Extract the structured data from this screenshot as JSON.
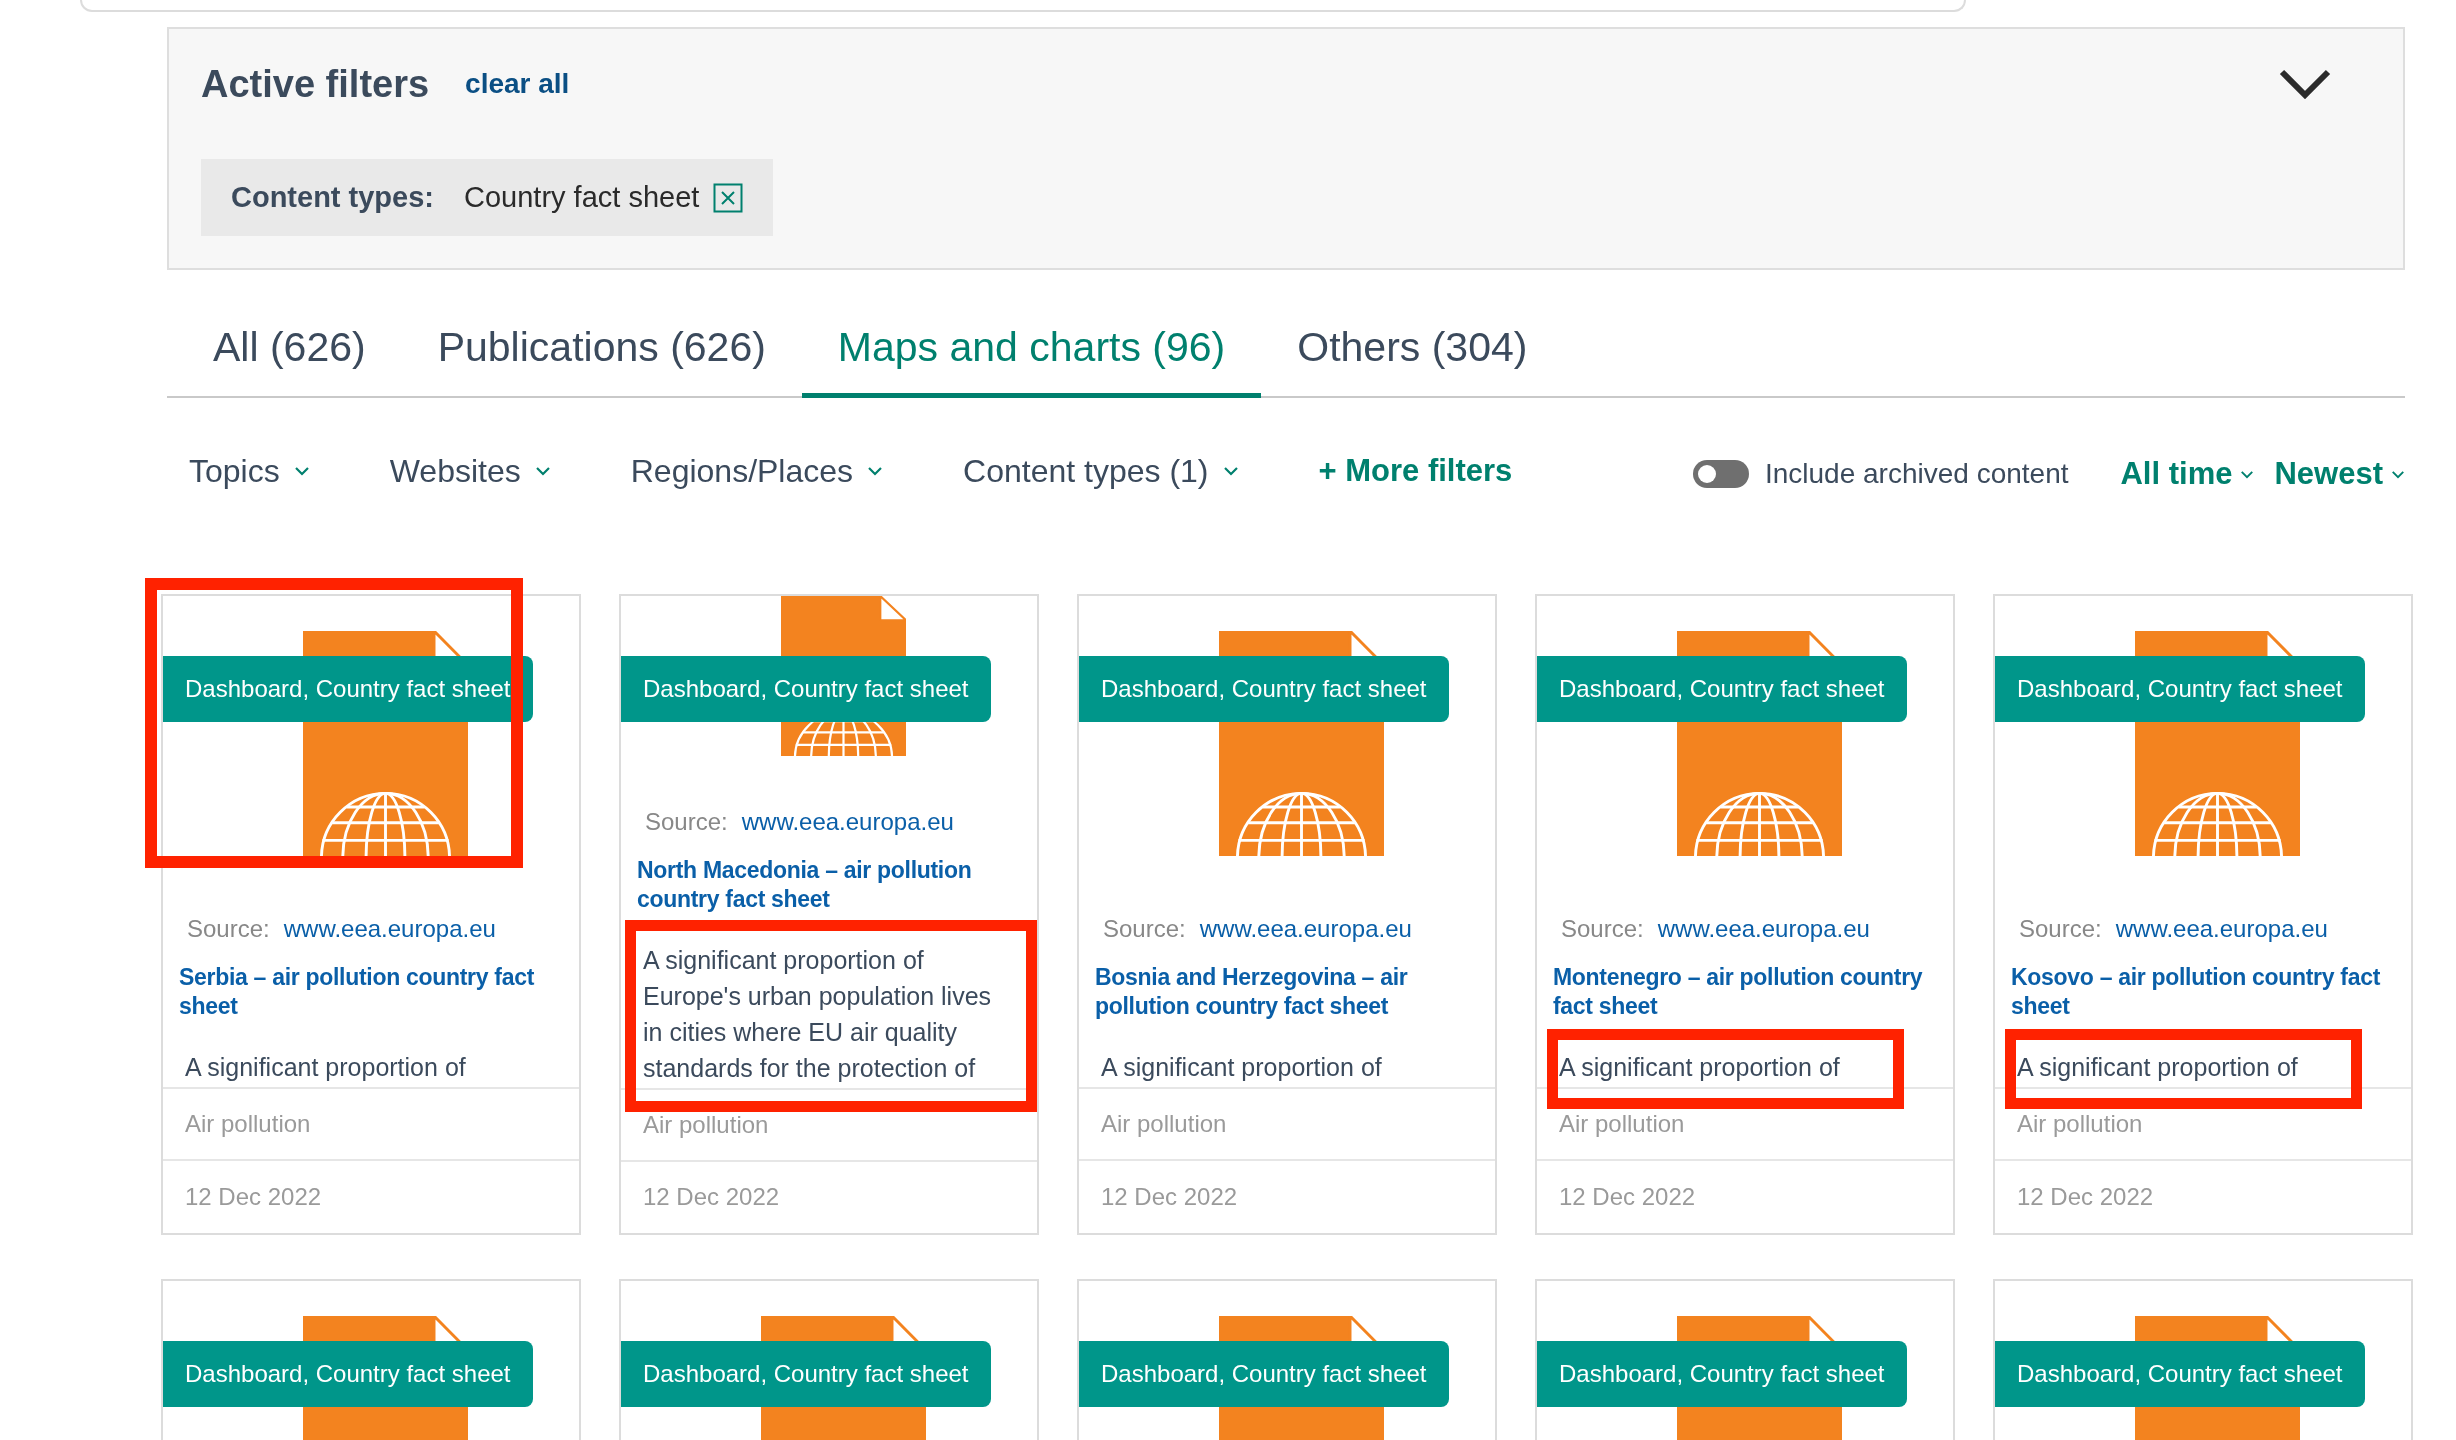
{
  "active_filters": {
    "title": "Active filters",
    "clear_label": "clear all",
    "expanded": true,
    "chips": [
      {
        "label": "Content types:",
        "value": "Country fact sheet"
      }
    ]
  },
  "tabs": [
    {
      "label": "All (626)",
      "selected": false
    },
    {
      "label": "Publications (626)",
      "selected": false
    },
    {
      "label": "Maps and charts (96)",
      "selected": true
    },
    {
      "label": "Others (304)",
      "selected": false
    }
  ],
  "filters": [
    {
      "label": "Topics"
    },
    {
      "label": "Websites"
    },
    {
      "label": "Regions/Places"
    },
    {
      "label": "Content types (1)"
    }
  ],
  "more_filters": "+ More filters",
  "archived": {
    "label": "Include archived content",
    "on": false
  },
  "sort": [
    {
      "label": "All time"
    },
    {
      "label": "Newest"
    }
  ],
  "cards": [
    {
      "badge": "Dashboard, Country fact sheet",
      "source_label": "Source:",
      "source": "www.eea.europa.eu",
      "title": "Serbia – air pollution country fact sheet",
      "description": "A significant proportion of",
      "topic": "Air pollution",
      "date": "12 Dec 2022",
      "image_highlighted": true,
      "description_highlighted": false,
      "image_cropped": false
    },
    {
      "badge": "Dashboard, Country fact sheet",
      "source_label": "Source:",
      "source": "www.eea.europa.eu",
      "title": "North Macedonia – air pollution country fact sheet",
      "description": "A significant proportion of Europe's urban population lives in cities where EU air quality standards for the protection of",
      "topic": "Air pollution",
      "date": "12 Dec 2022",
      "image_highlighted": false,
      "description_highlighted": true,
      "image_cropped": true
    },
    {
      "badge": "Dashboard, Country fact sheet",
      "source_label": "Source:",
      "source": "www.eea.europa.eu",
      "title": "Bosnia and Herzegovina – air pollution country fact sheet",
      "description": "A significant proportion of",
      "topic": "Air pollution",
      "date": "12 Dec 2022",
      "image_highlighted": false,
      "description_highlighted": false,
      "image_cropped": false
    },
    {
      "badge": "Dashboard, Country fact sheet",
      "source_label": "Source:",
      "source": "www.eea.europa.eu",
      "title": "Montenegro – air pollution country fact sheet",
      "description": "A significant proportion of",
      "topic": "Air pollution",
      "date": "12 Dec 2022",
      "image_highlighted": false,
      "description_highlighted": true,
      "image_cropped": false
    },
    {
      "badge": "Dashboard, Country fact sheet",
      "source_label": "Source:",
      "source": "www.eea.europa.eu",
      "title": "Kosovo – air pollution country fact sheet",
      "description": "A significant proportion of",
      "topic": "Air pollution",
      "date": "12 Dec 2022",
      "image_highlighted": false,
      "description_highlighted": true,
      "image_cropped": false
    }
  ],
  "more_cards": [
    {
      "badge": "Dashboard, Country fact sheet"
    },
    {
      "badge": "Dashboard, Country fact sheet"
    },
    {
      "badge": "Dashboard, Country fact sheet"
    },
    {
      "badge": "Dashboard, Country fact sheet"
    },
    {
      "badge": "Dashboard, Country fact sheet"
    }
  ]
}
